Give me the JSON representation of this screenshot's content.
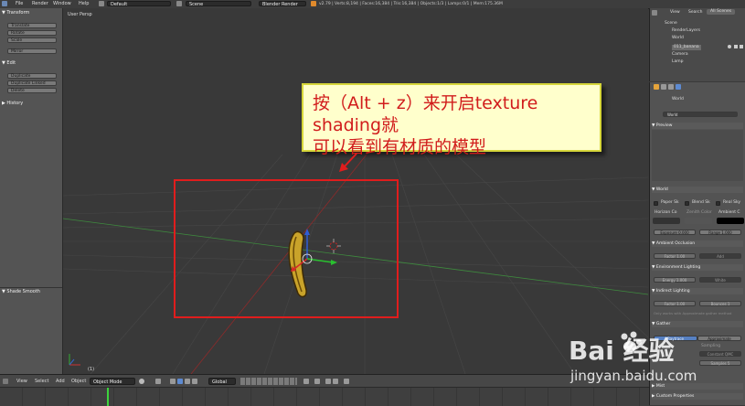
{
  "topbar": {
    "menus": [
      "File",
      "Render",
      "Window",
      "Help"
    ],
    "layout": "Default",
    "scene": "Scene",
    "engine": "Blender Render",
    "stats": "v2.79 | Verts:8,194 | Faces:16,384 | Tris:16,384 | Objects:1/3 | Lamps:0/1 | Mem:175.36M"
  },
  "toolshelf": {
    "transform_header": "▼ Transform",
    "transform_tools": [
      "Translate",
      "Rotate",
      "Scale"
    ],
    "mirror": "Mirror",
    "edit_header": "▼ Edit",
    "edit_tools": [
      "Duplicate",
      "Duplicate Linked",
      "Delete"
    ],
    "history_header": "▶ History",
    "shade_smooth": "▼ Shade Smooth"
  },
  "viewport": {
    "label": "User Persp",
    "frame_label": "(1)"
  },
  "outliner": {
    "tabs": [
      "View",
      "Search",
      "All Scenes"
    ],
    "items": [
      "Scene",
      "RenderLayers",
      "World",
      "011_banana",
      "Camera",
      "Lamp"
    ]
  },
  "properties": {
    "world_name": "World",
    "world_field": "World",
    "preview": "▼ Preview",
    "world_panel": "▼ World",
    "checks": [
      "Paper Sk",
      "Blend Sk",
      "Real Sky"
    ],
    "color_labels": [
      "Horizon Co",
      "Zenith Color",
      "Ambient C"
    ],
    "exposure": "Exposure 0.000",
    "range": "Range 1.000",
    "ambient_occlusion": "▼ Ambient Occlusion",
    "factor1": "Factor   1.00",
    "add": "Add",
    "environment_lighting": "▼ Environment Lighting",
    "energy": "Energy   1.000",
    "white": "White",
    "indirect_lighting": "▼ Indirect Lighting",
    "factor2": "Factor   1.00",
    "bounces": "Bounces   1",
    "hint": "Only works with Approximate gather method",
    "gather": "▼ Gather",
    "raytrace": "Raytrace",
    "approximate": "Approximate",
    "sampling": "Sampling",
    "constant_qmc": "Constant QMC",
    "samples": "Samples   5",
    "mist": "▶ Mist",
    "custom_properties": "▶ Custom Properties"
  },
  "bottombar": {
    "menus": [
      "View",
      "Select",
      "Add",
      "Object"
    ],
    "mode": "Object Mode",
    "orientation": "Global"
  },
  "annotation": {
    "line1": "按（Alt + z）来开启texture shading就",
    "line2": "可以看到有材质的模型"
  },
  "watermark": {
    "brand": "Bai 经验",
    "url": "jingyan.baidu.com"
  },
  "colors": {
    "annotation_text": "#d11c1c",
    "annotation_bg": "#ffffcc",
    "highlight_box": "#e01d1d",
    "grid_x_axis": "#8e2a2a",
    "grid_y_axis": "#3e8a3e"
  }
}
